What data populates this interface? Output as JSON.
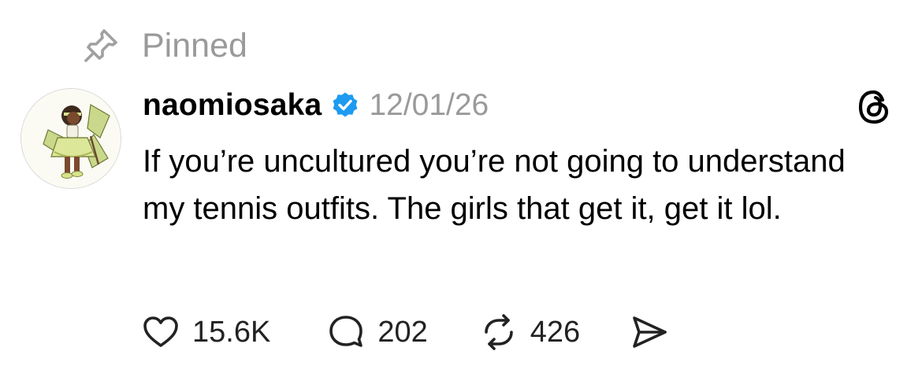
{
  "pinned": {
    "label": "Pinned",
    "icon": "pin-icon"
  },
  "post": {
    "author": {
      "username": "naomiosaka",
      "verified": true,
      "verified_color": "#1d9bf0",
      "avatar_icon": "avatar"
    },
    "timestamp": "12/01/26",
    "text": "If you’re uncultured you’re not going to understand my tennis outfits. The girls that get it, get it lol.",
    "app_icon": "threads-icon"
  },
  "actions": {
    "likes": {
      "icon": "heart-icon",
      "count": "15.6K"
    },
    "replies": {
      "icon": "comment-icon",
      "count": "202"
    },
    "reposts": {
      "icon": "repost-icon",
      "count": "426"
    },
    "share": {
      "icon": "send-icon"
    }
  },
  "colors": {
    "muted_text": "#9a9a9a",
    "primary_text": "#000000",
    "background": "#ffffff"
  }
}
